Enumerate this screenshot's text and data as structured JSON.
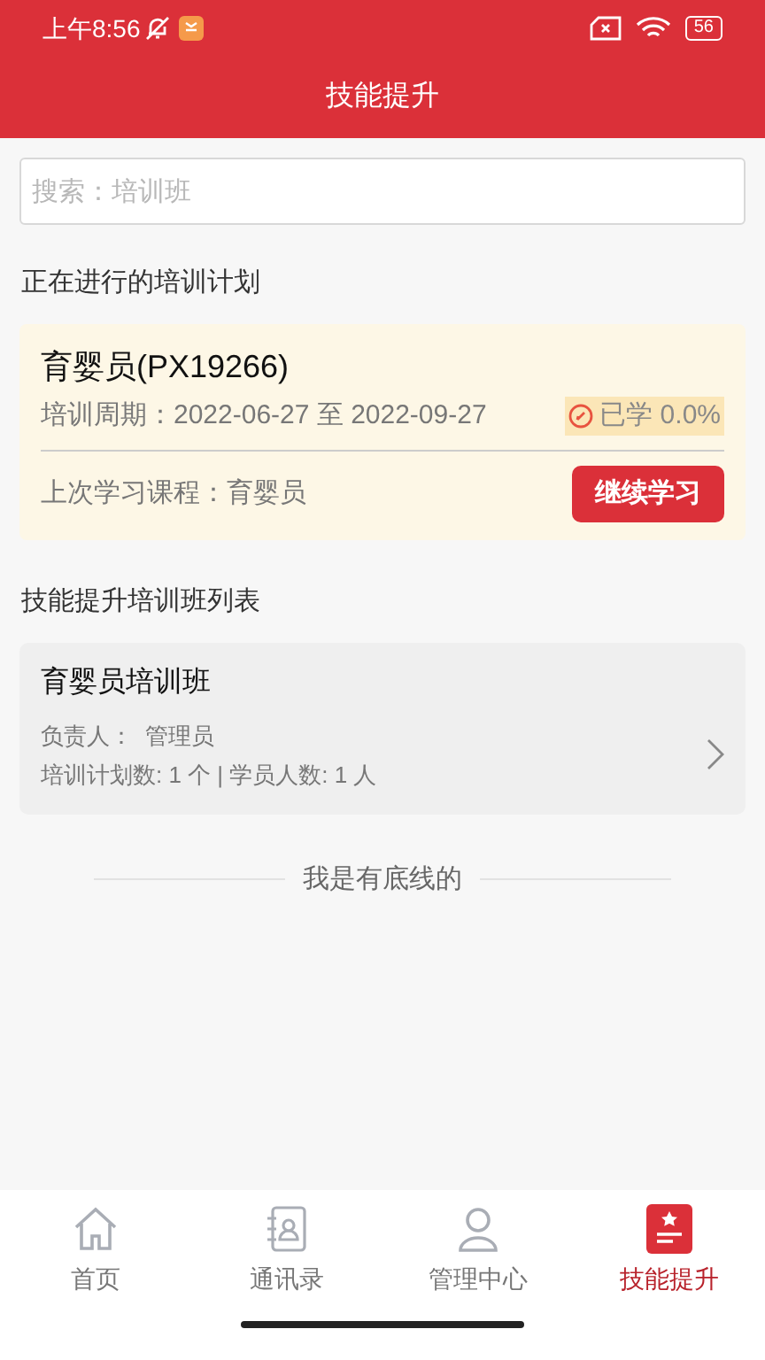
{
  "status_bar": {
    "time": "上午8:56",
    "battery": "56"
  },
  "header": {
    "title": "技能提升"
  },
  "search": {
    "placeholder": "搜索：培训班"
  },
  "current_section": {
    "title": "正在进行的培训计划",
    "plan": {
      "name": "育婴员(PX19266)",
      "period": "培训周期：2022-06-27 至 2022-09-27",
      "progress": "已学 0.0%",
      "last_course": "上次学习课程：育婴员",
      "button": "继续学习"
    }
  },
  "list_section": {
    "title": "技能提升培训班列表",
    "classes": [
      {
        "name": "育婴员培训班",
        "manager": "负责人：  管理员",
        "stats": "培训计划数: 1 个 | 学员人数: 1 人"
      }
    ]
  },
  "end_text": "我是有底线的",
  "tab_bar": [
    {
      "kind": "home",
      "label": "首页",
      "selected": false
    },
    {
      "kind": "contacts",
      "label": "通讯录",
      "selected": false
    },
    {
      "kind": "person",
      "label": "管理中心",
      "selected": false
    },
    {
      "kind": "skill",
      "label": "技能提升",
      "selected": true
    }
  ]
}
